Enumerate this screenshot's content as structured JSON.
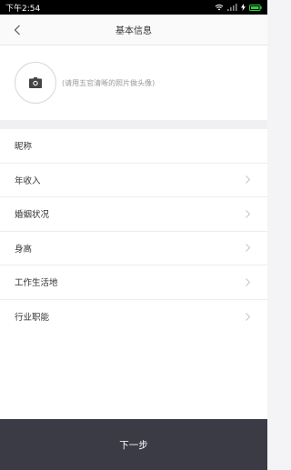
{
  "status_bar": {
    "time": "下午2:54"
  },
  "nav": {
    "title": "基本信息"
  },
  "avatar": {
    "hint": "(请用五官清晰的照片做头像)"
  },
  "list": {
    "items": [
      {
        "label": "昵称",
        "has_chevron": false
      },
      {
        "label": "年收入",
        "has_chevron": true
      },
      {
        "label": "婚姻状况",
        "has_chevron": true
      },
      {
        "label": "身高",
        "has_chevron": true
      },
      {
        "label": "工作生活地",
        "has_chevron": true
      },
      {
        "label": "行业职能",
        "has_chevron": true
      }
    ]
  },
  "footer": {
    "next_label": "下一步"
  },
  "colors": {
    "footer_bg": "#3a3b44",
    "status_bg": "#000000",
    "battery": "#2ecc40"
  }
}
